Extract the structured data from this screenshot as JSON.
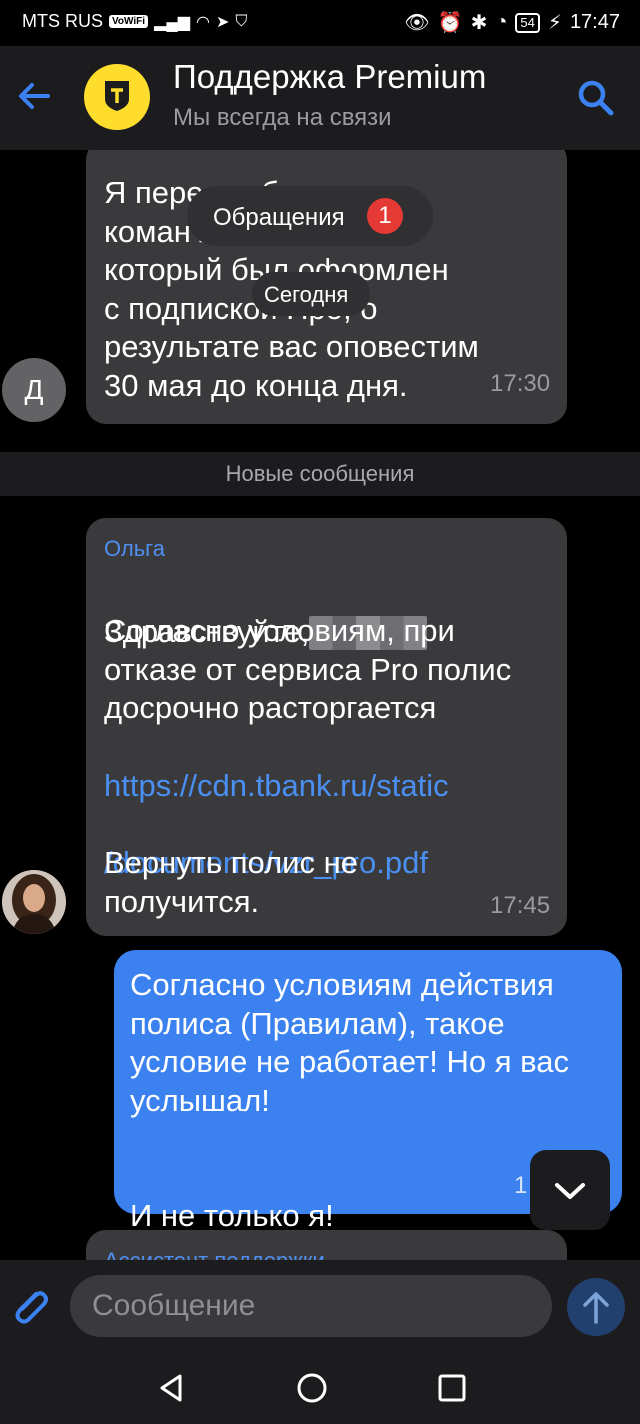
{
  "status": {
    "carrier": "MTS RUS",
    "vowifi": "VoWiFi",
    "battery": "54",
    "time": "17:47"
  },
  "header": {
    "title": "Поддержка Premium",
    "subtitle": "Мы всегда на связи"
  },
  "overlays": {
    "appeals_label": "Обращения",
    "appeals_count": "1",
    "date_label": "Сегодня"
  },
  "messages": {
    "first": {
      "avatar_letter": "Д",
      "lines": "Я пере                     осьбу\nкоман                      лис\nкоторый был оформлен\nс подпиской Про, о\nрезультате вас оповестим\n30 мая до конца дня.",
      "time": "17:30"
    },
    "new_messages_label": "Новые сообщения",
    "olga": {
      "sender": "Ольга",
      "greeting": "Здравствуйте,",
      "body": "Согласно условиям, при\nотказе от сервиса Pro полис\nдосрочно расторгается",
      "link_line1": "https://cdn.tbank.ru/static",
      "link_line2": "/documents/vzr_pro.pdf",
      "tail": "Вернуть полис не\nполучится.",
      "time": "17:45"
    },
    "outgoing": {
      "body": "Согласно условиям действия\nполиса (Правилам), такое\nусловие не работает! Но я вас\nуслышал!",
      "tail": "И не только я!",
      "time_partial": "1"
    },
    "next_sender_partial": "Ассистент поддержки"
  },
  "composer": {
    "placeholder": "Сообщение"
  },
  "colors": {
    "accent": "#3b82f0",
    "brand_yellow": "#ffdd2d",
    "badge_red": "#e53935"
  }
}
